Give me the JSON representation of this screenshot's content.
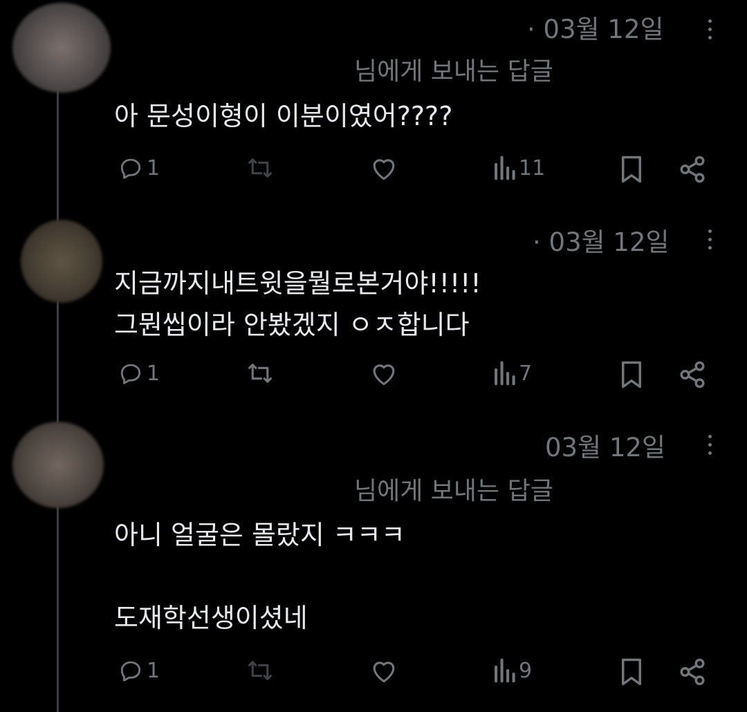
{
  "tweets": [
    {
      "date": "· 03월 12일",
      "replying_to": "님에게 보내는 답글",
      "text": "아 문성이형이 이분이였어????",
      "replies": "1",
      "views": "11"
    },
    {
      "date": "· 03월 12일",
      "replying_to": "",
      "text": "지금까지내트윗을뭘로본거야!!!!!\n그뭔씹이라 안봤겠지 ㅇㅈ합니다",
      "replies": "1",
      "views": "7"
    },
    {
      "date": "03월 12일",
      "replying_to": "님에게 보내는 답글",
      "text": "아니 얼굴은 몰랐지 ㅋㅋㅋ\n\n도재학선생이셨네",
      "replies": "1",
      "views": "9"
    }
  ],
  "icons": [
    "more-icon",
    "reply-icon",
    "retweet-icon",
    "like-icon",
    "views-icon",
    "bookmark-icon",
    "share-icon"
  ]
}
